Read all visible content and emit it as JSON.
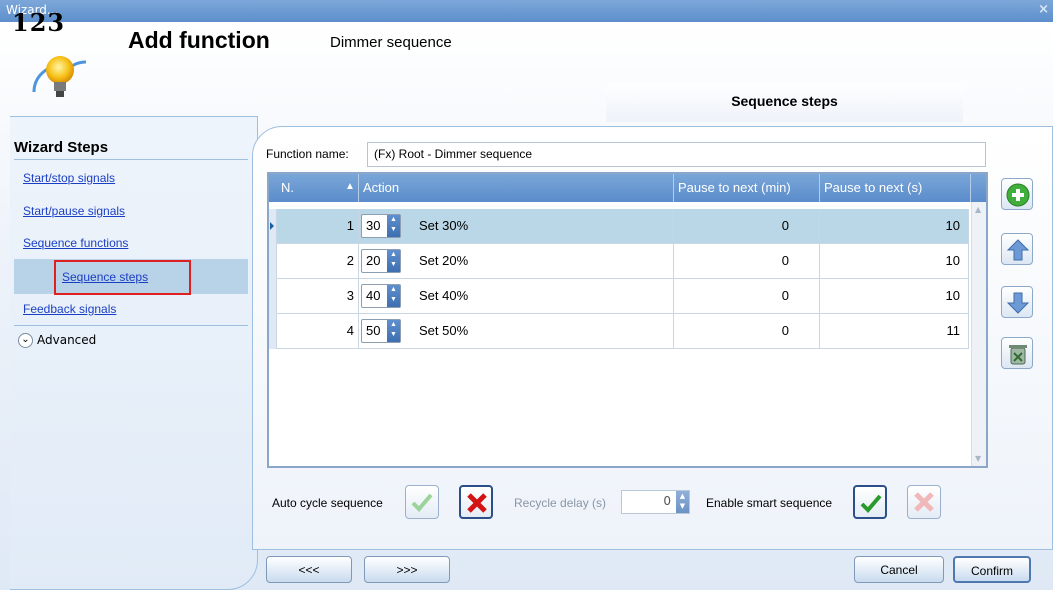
{
  "window": {
    "title": "Wizard...",
    "close_glyph": "×"
  },
  "header": {
    "logo_numbers": "123",
    "title": "Add function",
    "subtitle": "Dimmer sequence"
  },
  "tab": {
    "label": "Sequence steps"
  },
  "wizard_steps": {
    "heading": "Wizard Steps",
    "items": [
      {
        "label": "Start/stop signals"
      },
      {
        "label": "Start/pause signals"
      },
      {
        "label": "Sequence functions"
      },
      {
        "label": "Sequence steps",
        "selected": true
      },
      {
        "label": "Feedback signals"
      }
    ],
    "advanced_label": "Advanced"
  },
  "function": {
    "name_label": "Function name:",
    "name_value": "(Fx) Root - Dimmer sequence"
  },
  "grid": {
    "columns": [
      "N.",
      "Action",
      "Pause to next (min)",
      "Pause to next (s)"
    ],
    "rows": [
      {
        "n": "1",
        "level": "30",
        "action": "Set 30%",
        "pause_min": "0",
        "pause_s": "10"
      },
      {
        "n": "2",
        "level": "20",
        "action": "Set 20%",
        "pause_min": "0",
        "pause_s": "10"
      },
      {
        "n": "3",
        "level": "40",
        "action": "Set 40%",
        "pause_min": "0",
        "pause_s": "10"
      },
      {
        "n": "4",
        "level": "50",
        "action": "Set 50%",
        "pause_min": "0",
        "pause_s": "11"
      }
    ]
  },
  "side_buttons": [
    "add-icon",
    "move-up-icon",
    "move-down-icon",
    "delete-icon"
  ],
  "options": {
    "auto_cycle_label": "Auto cycle sequence",
    "recycle_delay_label": "Recycle delay (s)",
    "recycle_delay_value": "0",
    "smart_sequence_label": "Enable smart sequence"
  },
  "footer": {
    "prev": "<<<",
    "next": ">>>",
    "cancel": "Cancel",
    "confirm": "Confirm"
  },
  "colors": {
    "header_blue": "#5b8ccb",
    "link": "#1b3fc4",
    "selected_row": "#b9d7e6",
    "highlight_box": "#e02020"
  }
}
